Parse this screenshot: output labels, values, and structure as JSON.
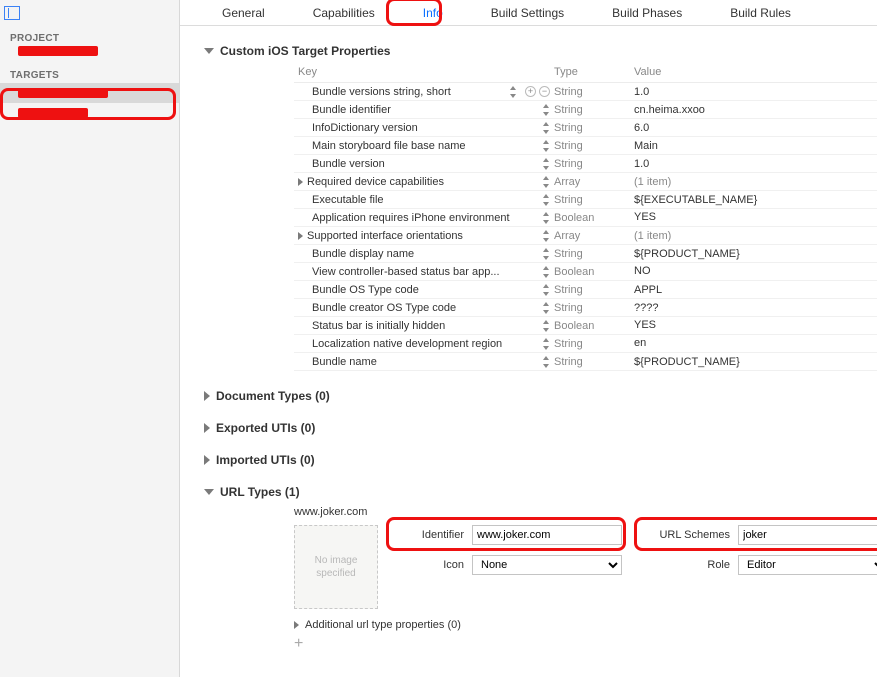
{
  "sidebar": {
    "project_label": "PROJECT",
    "targets_label": "TARGETS"
  },
  "tabs": {
    "general": "General",
    "capabilities": "Capabilities",
    "info": "Info",
    "build_settings": "Build Settings",
    "build_phases": "Build Phases",
    "build_rules": "Build Rules"
  },
  "custom_props": {
    "title": "Custom iOS Target Properties",
    "cols": {
      "key": "Key",
      "type": "Type",
      "value": "Value"
    },
    "rows": [
      {
        "key": "Bundle versions string, short",
        "type": "String",
        "value": "1.0",
        "hover": true
      },
      {
        "key": "Bundle identifier",
        "type": "String",
        "value": "cn.heima.xxoo"
      },
      {
        "key": "InfoDictionary version",
        "type": "String",
        "value": "6.0"
      },
      {
        "key": "Main storyboard file base name",
        "type": "String",
        "value": "Main"
      },
      {
        "key": "Bundle version",
        "type": "String",
        "value": "1.0"
      },
      {
        "key": "Required device capabilities",
        "type": "Array",
        "value": "(1 item)",
        "expandable": true
      },
      {
        "key": "Executable file",
        "type": "String",
        "value": "${EXECUTABLE_NAME}"
      },
      {
        "key": "Application requires iPhone environment",
        "type": "Boolean",
        "value": "YES",
        "val_stepper": true
      },
      {
        "key": "Supported interface orientations",
        "type": "Array",
        "value": "(1 item)",
        "expandable": true
      },
      {
        "key": "Bundle display name",
        "type": "String",
        "value": "${PRODUCT_NAME}"
      },
      {
        "key": "View controller-based status bar app...",
        "type": "Boolean",
        "value": "NO",
        "val_stepper": true
      },
      {
        "key": "Bundle OS Type code",
        "type": "String",
        "value": "APPL"
      },
      {
        "key": "Bundle creator OS Type code",
        "type": "String",
        "value": "????"
      },
      {
        "key": "Status bar is initially hidden",
        "type": "Boolean",
        "value": "YES",
        "val_stepper": true
      },
      {
        "key": "Localization native development region",
        "type": "String",
        "value": "en",
        "val_stepper": true
      },
      {
        "key": "Bundle name",
        "type": "String",
        "value": "${PRODUCT_NAME}"
      }
    ]
  },
  "sections": {
    "doc_types": "Document Types (0)",
    "exported_utis": "Exported UTIs (0)",
    "imported_utis": "Imported UTIs (0)",
    "url_types": "URL Types (1)"
  },
  "url_types": {
    "name": "www.joker.com",
    "dropzone": "No image specified",
    "labels": {
      "identifier": "Identifier",
      "url_schemes": "URL Schemes",
      "icon": "Icon",
      "role": "Role"
    },
    "values": {
      "identifier": "www.joker.com",
      "url_schemes": "joker",
      "icon_placeholder": "None",
      "role": "Editor"
    },
    "additional": "Additional url type properties (0)"
  }
}
